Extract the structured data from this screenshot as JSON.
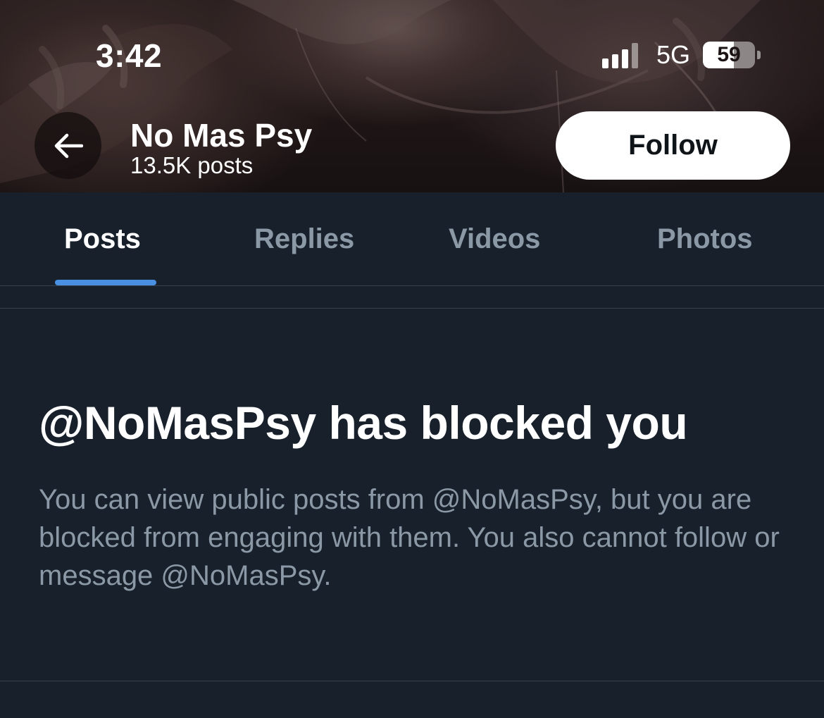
{
  "status_bar": {
    "time": "3:42",
    "network": "5G",
    "battery_level": "59",
    "battery_fraction": 0.59,
    "signal_bars_active": 3,
    "signal_bars_total": 4
  },
  "header": {
    "profile_name": "No Mas Psy",
    "post_count": "13.5K posts",
    "follow_label": "Follow",
    "back_icon": "arrow-left-icon"
  },
  "tabs": [
    {
      "label": "Posts",
      "active": true
    },
    {
      "label": "Replies",
      "active": false
    },
    {
      "label": "Videos",
      "active": false
    },
    {
      "label": "Photos",
      "active": false
    }
  ],
  "blocked": {
    "title": "@NoMasPsy has blocked you",
    "description": "You can view public posts from @NoMasPsy, but you are blocked from engaging with them. You also cannot follow or message @NoMasPsy."
  },
  "colors": {
    "background": "#18202b",
    "tab_indicator": "#4a90e2",
    "muted_text": "#8b98a5",
    "divider": "#38444d"
  }
}
